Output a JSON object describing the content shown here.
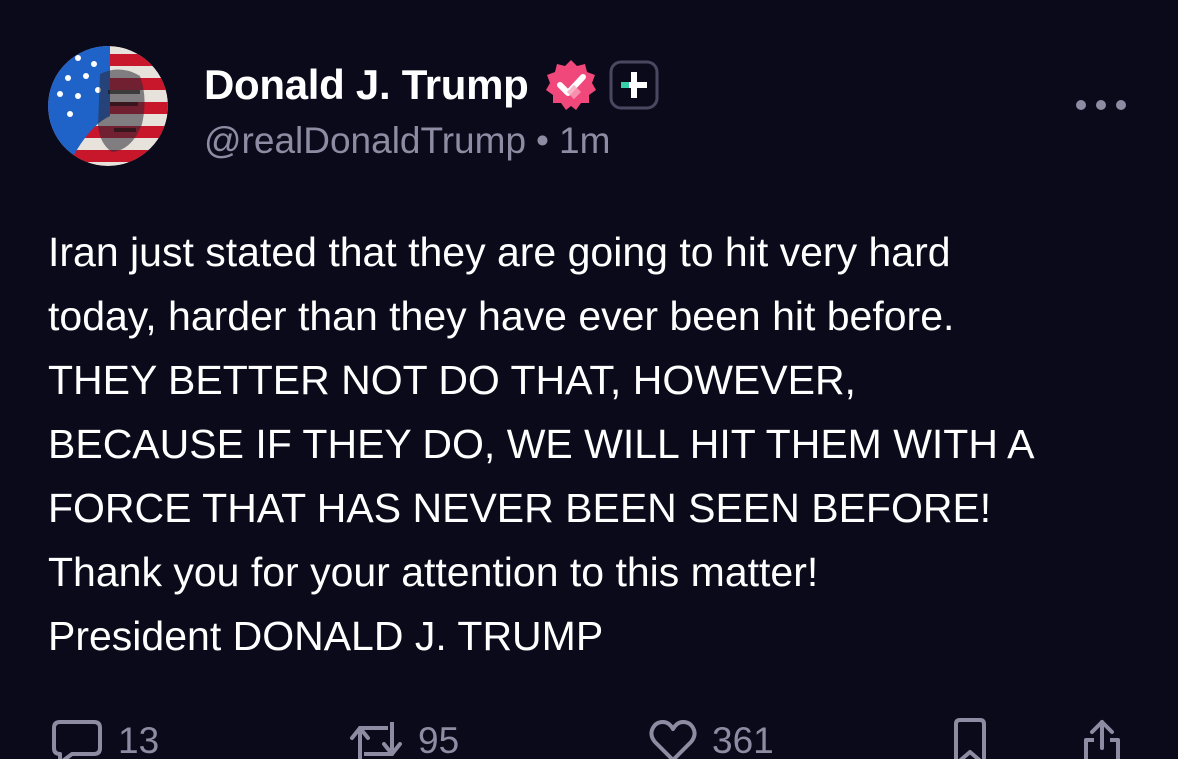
{
  "user": {
    "display_name": "Donald J. Trump",
    "handle": "@realDonaldTrump",
    "separator": "•",
    "time_ago": "1m",
    "verified_badge_color": "#f0487a",
    "avatar_icon": "flag-portrait-avatar"
  },
  "post": {
    "lines": [
      "Iran just stated that they are going to hit very hard",
      "today, harder than they have ever been hit before.",
      "THEY BETTER NOT DO THAT, HOWEVER,",
      "BECAUSE IF THEY DO, WE WILL HIT THEM WITH A",
      "FORCE THAT HAS NEVER BEEN SEEN BEFORE!",
      "Thank you for your attention to this matter!",
      "President DONALD J. TRUMP"
    ]
  },
  "actions": {
    "replies": {
      "icon": "comment-icon",
      "count": "13"
    },
    "reposts": {
      "icon": "repost-icon",
      "count": "95"
    },
    "likes": {
      "icon": "heart-icon",
      "count": "361"
    },
    "bookmark": {
      "icon": "bookmark-icon"
    },
    "share": {
      "icon": "share-icon"
    }
  },
  "colors": {
    "background": "#0b0a1a",
    "text": "#ffffff",
    "muted": "#8e8ca3",
    "accent_teal": "#37d0a8"
  }
}
